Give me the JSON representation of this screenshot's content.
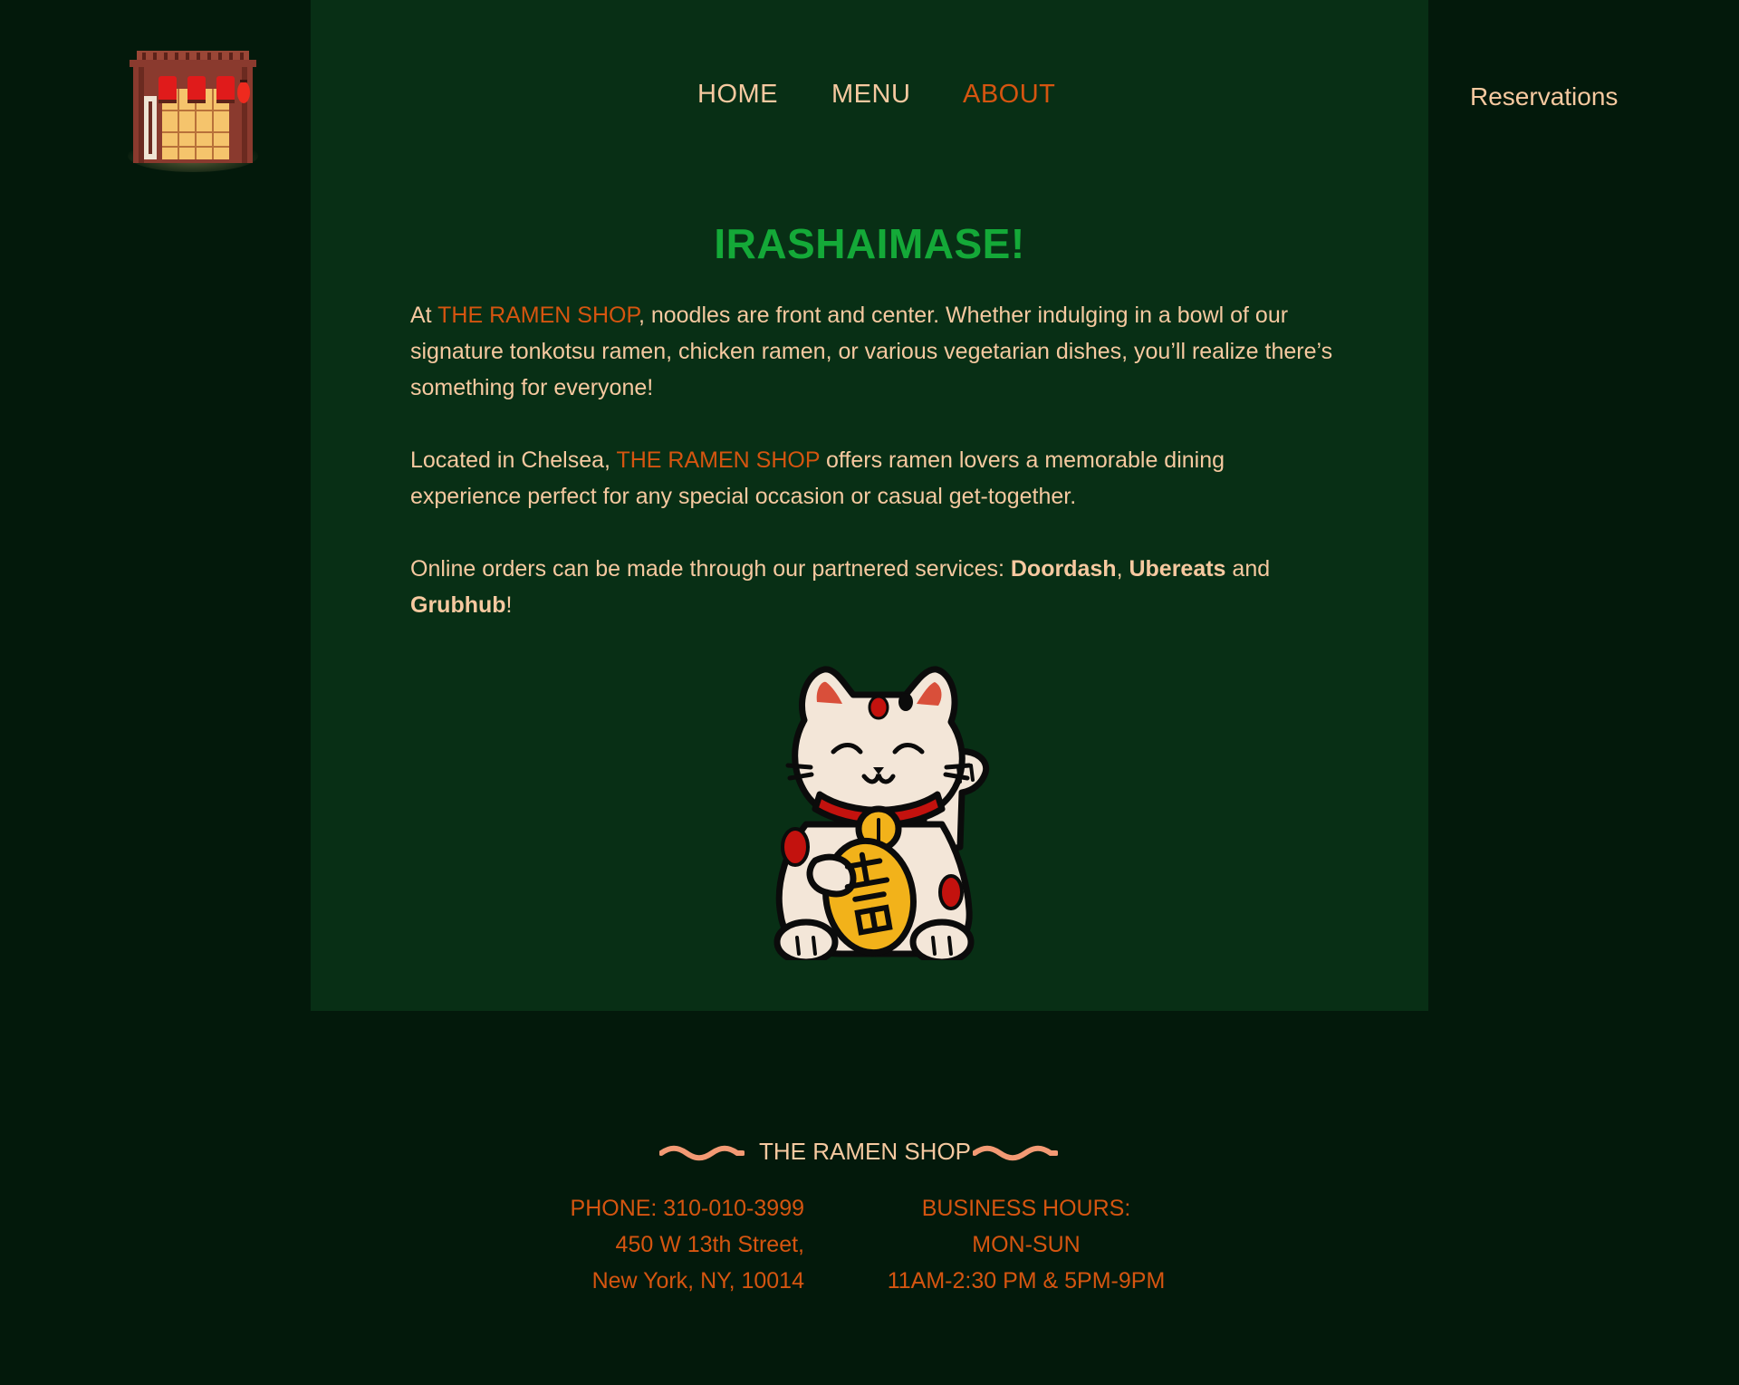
{
  "brand": {
    "logo_icon": "ramen-shop-storefront-icon",
    "mascot_icon": "maneki-neko-cat-icon"
  },
  "nav": {
    "items": [
      {
        "label": "HOME",
        "active": false
      },
      {
        "label": "MENU",
        "active": false
      },
      {
        "label": "ABOUT",
        "active": true
      }
    ],
    "reservations_label": "Reservations"
  },
  "about": {
    "heading": "IRASHAIMASE!",
    "p1": {
      "before": "At ",
      "brand": "THE RAMEN SHOP",
      "after": ", noodles are front and center. Whether indulging in a bowl of our signature tonkotsu ramen, chicken ramen, or various vegetarian dishes, you’ll realize there’s something for everyone!"
    },
    "p2": {
      "before": "Located in Chelsea, ",
      "brand": "THE RAMEN SHOP",
      "after": " offers ramen lovers a memorable dining experience perfect for any special occasion or casual get-together."
    },
    "p3": {
      "before": "Online orders can be made through our partnered services: ",
      "service1": "Doordash",
      "sep1": ", ",
      "service2": "Ubereats",
      "sep2": " and ",
      "service3": "Grubhub",
      "end": "!"
    }
  },
  "footer": {
    "name": "THE RAMEN SHOP",
    "phone": "PHONE: 310-010-3999",
    "address_line1": "450 W 13th Street,",
    "address_line2": "New York, NY, 10014",
    "hours_title": "BUSINESS HOURS:",
    "hours_days": "MON-SUN",
    "hours_times": "11AM-2:30 PM & 5PM-9PM"
  },
  "colors": {
    "page_bg": "#03190b",
    "panel_bg": "#082f15",
    "text_peach": "#f6c9a0",
    "accent_orange": "#d55510",
    "heading_green": "#14a938"
  }
}
